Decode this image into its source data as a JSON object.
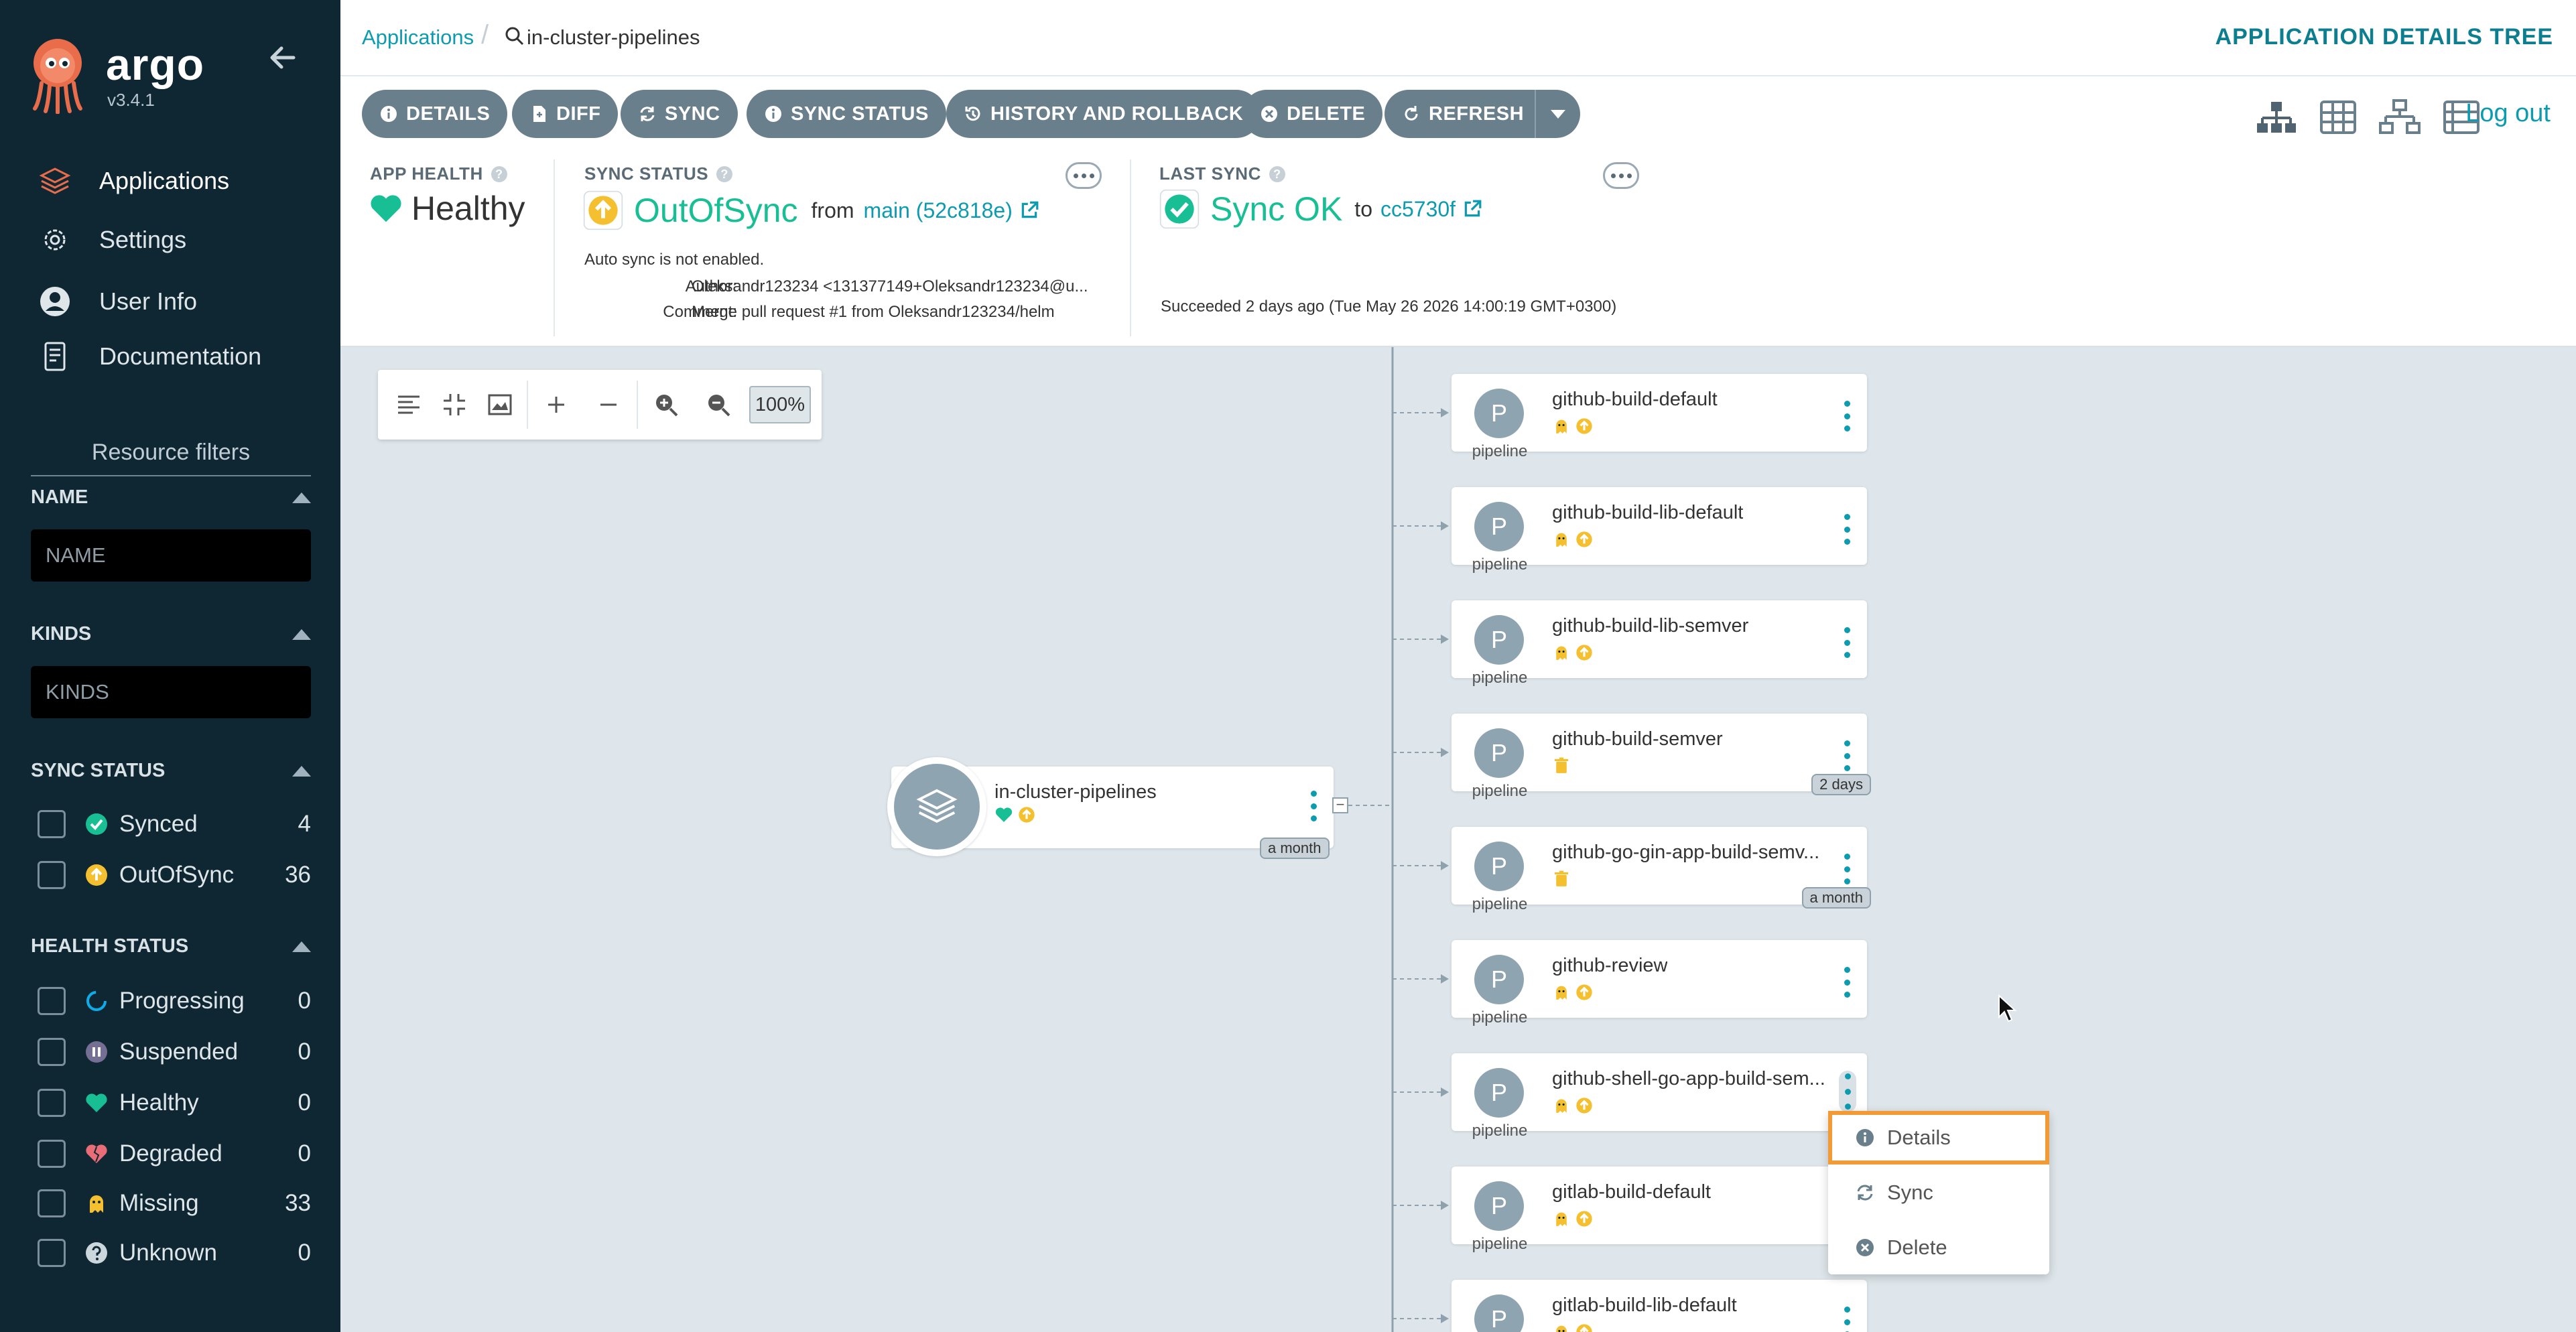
{
  "sidebar": {
    "brand": "argo",
    "version": "v3.4.1",
    "nav": [
      {
        "label": "Applications",
        "icon": "applications-icon"
      },
      {
        "label": "Settings",
        "icon": "settings-icon"
      },
      {
        "label": "User Info",
        "icon": "user-icon"
      },
      {
        "label": "Documentation",
        "icon": "documentation-icon"
      }
    ],
    "filters_title": "Resource filters",
    "name_label": "NAME",
    "name_placeholder": "NAME",
    "kinds_label": "KINDS",
    "kinds_placeholder": "KINDS",
    "sync_status_label": "SYNC STATUS",
    "sync_items": [
      {
        "label": "Synced",
        "count": "4"
      },
      {
        "label": "OutOfSync",
        "count": "36"
      }
    ],
    "health_status_label": "HEALTH STATUS",
    "health_items": [
      {
        "label": "Progressing",
        "count": "0"
      },
      {
        "label": "Suspended",
        "count": "0"
      },
      {
        "label": "Healthy",
        "count": "0"
      },
      {
        "label": "Degraded",
        "count": "0"
      },
      {
        "label": "Missing",
        "count": "33"
      },
      {
        "label": "Unknown",
        "count": "0"
      }
    ]
  },
  "topbar": {
    "breadcrumb_root": "Applications",
    "breadcrumb_app": "in-cluster-pipelines",
    "page_kind": "APPLICATION DETAILS TREE"
  },
  "toolbar": {
    "buttons": [
      "DETAILS",
      "DIFF",
      "SYNC",
      "SYNC STATUS",
      "HISTORY AND ROLLBACK",
      "DELETE",
      "REFRESH"
    ],
    "logout": "Log out"
  },
  "status": {
    "app_health_label": "APP HEALTH",
    "app_health_value": "Healthy",
    "sync_status_label": "SYNC STATUS",
    "sync_status_value": "OutOfSync",
    "from_text": "from",
    "revision_link": "main (52c818e)",
    "auto_sync": "Auto sync is not enabled.",
    "author_label": "Author:",
    "author_value": "Oleksandr123234 <131377149+Oleksandr123234@u...",
    "comment_label": "Comment:",
    "comment_value": "Merge pull request #1 from Oleksandr123234/helm",
    "last_sync_label": "LAST SYNC",
    "last_sync_value": "Sync OK",
    "to_text": "to",
    "last_sync_revision": "cc5730f",
    "succeeded_text": "Succeeded 2 days ago (Tue May 26 2026 14:00:19 GMT+0300)"
  },
  "graph": {
    "zoom": "100%",
    "root": {
      "name": "in-cluster-pipelines",
      "age": "a month"
    },
    "kind_label": "pipeline",
    "icon_letter": "P",
    "nodes": [
      {
        "name": "github-build-default",
        "age": ""
      },
      {
        "name": "github-build-lib-default",
        "age": ""
      },
      {
        "name": "github-build-lib-semver",
        "age": ""
      },
      {
        "name": "github-build-semver",
        "age": "2 days"
      },
      {
        "name": "github-go-gin-app-build-semv...",
        "age": "a month"
      },
      {
        "name": "github-review",
        "age": ""
      },
      {
        "name": "github-shell-go-app-build-sem...",
        "age": ""
      },
      {
        "name": "gitlab-build-default",
        "age": ""
      },
      {
        "name": "gitlab-build-lib-default",
        "age": ""
      }
    ]
  },
  "context_menu": {
    "items": [
      "Details",
      "Sync",
      "Delete"
    ]
  },
  "colors": {
    "sidebar_bg": "#0f2733",
    "accent": "#0d9bb0",
    "healthy": "#18be94",
    "out_of_sync": "#f4c030",
    "button_gray": "#6a7f8c",
    "highlight": "#f29a35"
  }
}
